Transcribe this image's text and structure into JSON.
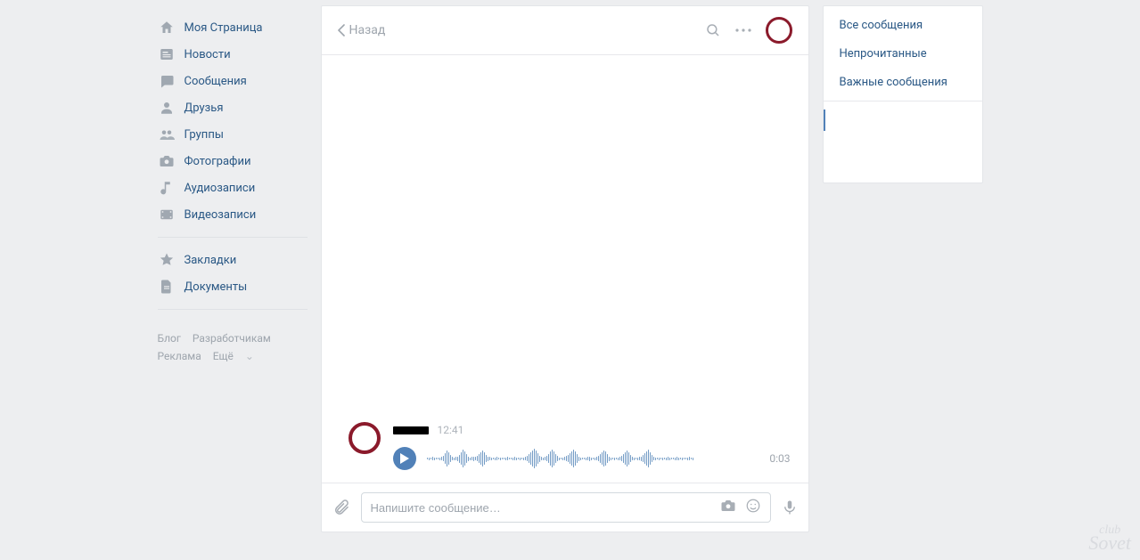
{
  "nav": {
    "items": [
      {
        "label": "Моя Страница",
        "icon": "home"
      },
      {
        "label": "Новости",
        "icon": "news"
      },
      {
        "label": "Сообщения",
        "icon": "messages"
      },
      {
        "label": "Друзья",
        "icon": "friends"
      },
      {
        "label": "Группы",
        "icon": "groups"
      },
      {
        "label": "Фотографии",
        "icon": "photos"
      },
      {
        "label": "Аудиозаписи",
        "icon": "audio"
      },
      {
        "label": "Видеозаписи",
        "icon": "video"
      }
    ],
    "secondary": [
      {
        "label": "Закладки",
        "icon": "bookmarks"
      },
      {
        "label": "Документы",
        "icon": "docs"
      }
    ]
  },
  "footer": {
    "blog": "Блог",
    "devs": "Разработчикам",
    "ads": "Реклама",
    "more": "Ещё"
  },
  "dialog": {
    "back_label": "Назад",
    "title": "",
    "message": {
      "time": "12:41",
      "voice_duration": "0:03"
    },
    "composer_placeholder": "Напишите сообщение…"
  },
  "filters": {
    "all": "Все сообщения",
    "unread": "Непрочитанные",
    "important": "Важные сообщения",
    "active": ""
  },
  "watermark": {
    "top": "club",
    "bottom": "Sovet"
  },
  "waveform_heights": [
    2,
    3,
    2,
    4,
    3,
    2,
    2,
    3,
    4,
    6,
    12,
    18,
    14,
    8,
    4,
    3,
    4,
    5,
    9,
    14,
    20,
    16,
    10,
    5,
    3,
    4,
    5,
    4,
    6,
    10,
    14,
    18,
    14,
    8,
    5,
    4,
    3,
    2,
    3,
    4,
    2,
    3,
    2,
    2,
    3,
    4,
    2,
    2,
    3,
    4,
    3,
    2,
    3,
    2,
    3,
    4,
    6,
    10,
    14,
    18,
    22,
    18,
    12,
    7,
    4,
    3,
    4,
    6,
    10,
    16,
    20,
    16,
    10,
    6,
    3,
    2,
    3,
    4,
    6,
    8,
    12,
    16,
    20,
    16,
    10,
    5,
    3,
    2,
    2,
    3,
    4,
    5,
    3,
    2,
    3,
    4,
    6,
    10,
    14,
    18,
    16,
    10,
    5,
    3,
    2,
    3,
    2,
    3,
    4,
    6,
    10,
    14,
    18,
    14,
    8,
    4,
    3,
    2,
    3,
    4,
    5,
    8,
    12,
    16,
    20,
    14,
    8,
    4,
    3,
    2,
    3,
    2,
    3,
    2,
    3,
    4,
    3,
    2,
    2,
    3,
    4,
    3,
    2,
    3,
    2,
    2,
    3,
    4,
    2,
    3
  ]
}
